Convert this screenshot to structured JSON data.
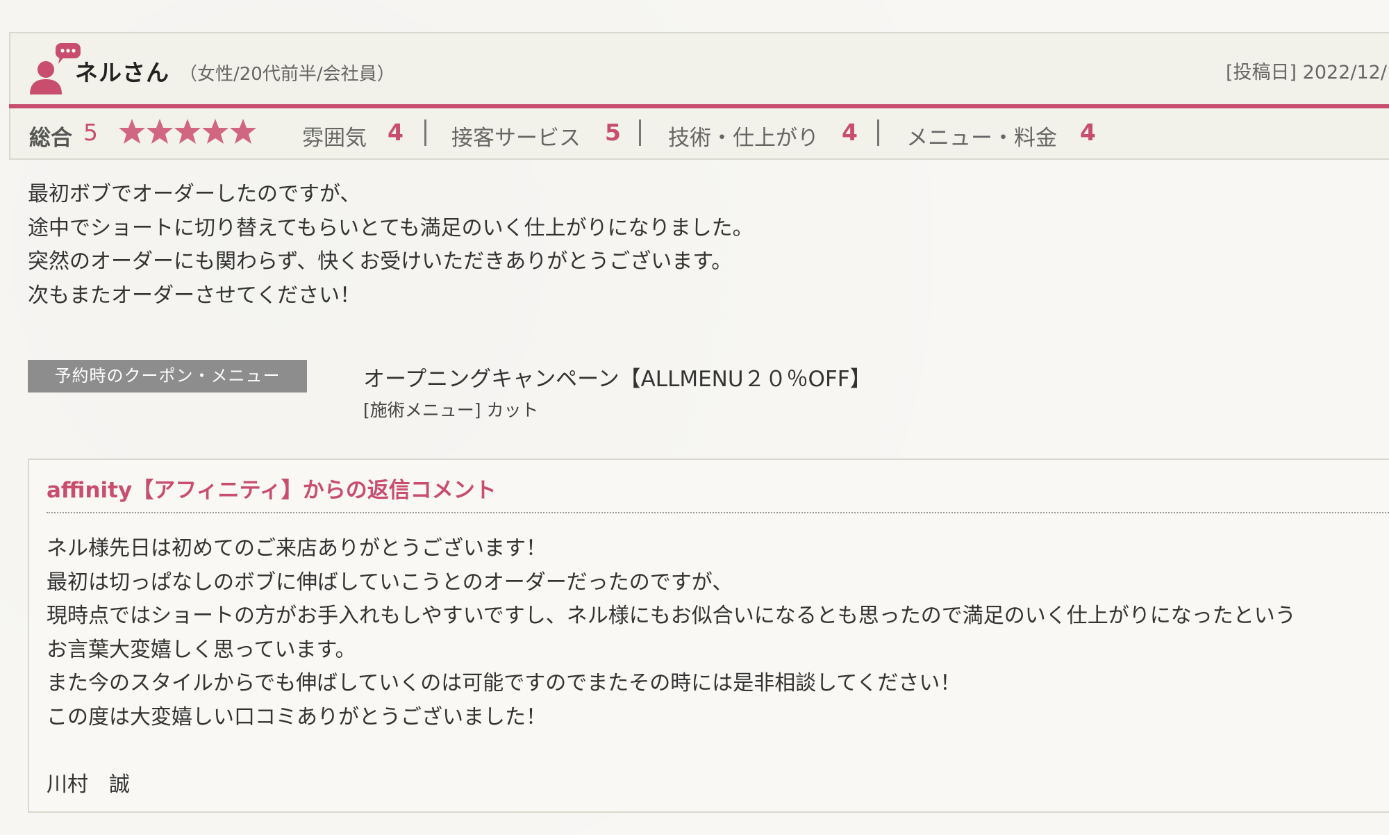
{
  "review": {
    "reviewer_name": "ネルさん",
    "reviewer_meta": "（女性/20代前半/会社員）",
    "post_date": "[投稿日] 2022/12/",
    "avatar_icon": "user-comment-icon",
    "colors": {
      "accent": "#c94d6c",
      "header_bg": "#f3f2ea"
    },
    "ratings": {
      "overall_label": "総合",
      "overall_value": "5",
      "stars": 5,
      "items": [
        {
          "label": "雰囲気",
          "value": "4"
        },
        {
          "label": "接客サービス",
          "value": "5"
        },
        {
          "label": "技術・仕上がり",
          "value": "4"
        },
        {
          "label": "メニュー・料金",
          "value": "4"
        }
      ]
    },
    "body_lines": [
      "最初ボブでオーダーしたのですが、",
      "途中でショートに切り替えてもらいとても満足のいく仕上がりになりました。",
      "突然のオーダーにも関わらず、快くお受けいただきありがとうございます。",
      "次もまたオーダーさせてください！"
    ]
  },
  "coupon": {
    "label": "予約時のクーポン・メニュー",
    "title": "オープニングキャンペーン【ALLMENU２０％OFF】",
    "menu": "[施術メニュー]  カット"
  },
  "reply": {
    "title": "affinity【アフィニティ】からの返信コメント",
    "lines": [
      "ネル様先日は初めてのご来店ありがとうございます！",
      "最初は切っぱなしのボブに伸ばしていこうとのオーダーだったのですが、",
      "現時点ではショートの方がお手入れもしやすいですし、ネル様にもお似合いになるとも思ったので満足のいく仕上がりになったという",
      "お言葉大変嬉しく思っています。",
      "また今のスタイルからでも伸ばしていくのは可能ですのでまたその時には是非相談してください！",
      "この度は大変嬉しい口コミありがとうございました！",
      "",
      "川村　誠"
    ]
  }
}
